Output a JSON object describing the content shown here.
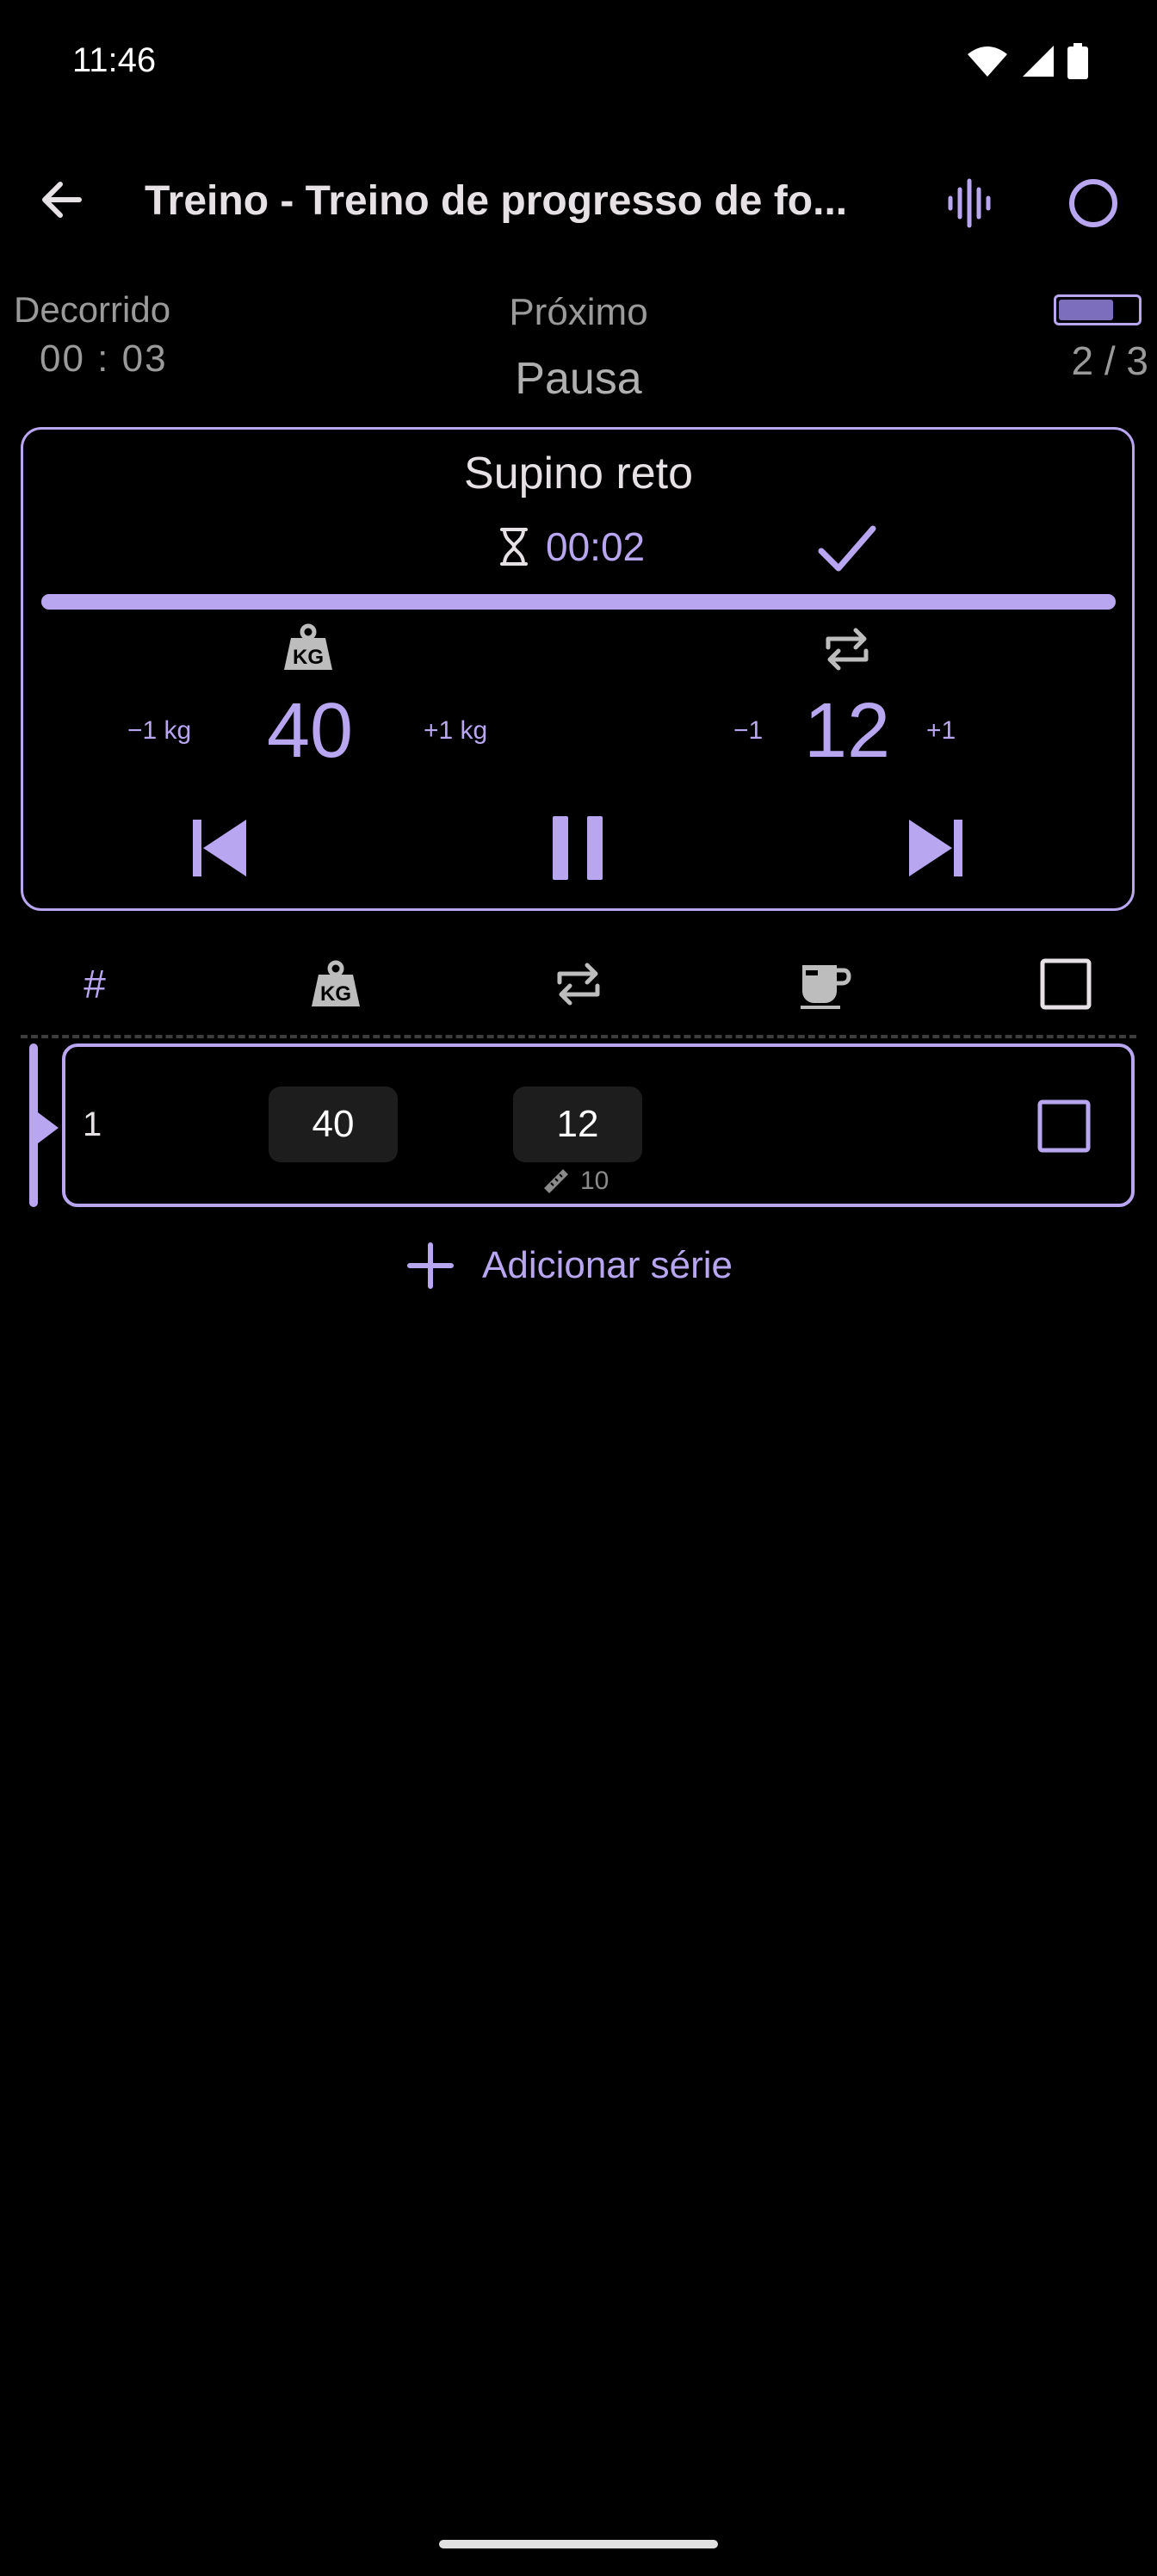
{
  "status_bar": {
    "time": "11:46"
  },
  "app_bar": {
    "title": "Treino - Treino de progresso de fo..."
  },
  "info": {
    "elapsed_label": "Decorrido",
    "elapsed_value": "00 : 03",
    "next_label": "Próximo",
    "next_value": "Pausa",
    "progress_count": "2 / 3",
    "battery_level": 0.7
  },
  "exercise": {
    "name": "Supino reto",
    "timer": "00:02",
    "progress_fraction": 1.0,
    "weight": {
      "minus_label": "−1 kg",
      "value": "40",
      "plus_label": "+1 kg"
    },
    "reps": {
      "minus_label": "−1",
      "value": "12",
      "plus_label": "+1"
    }
  },
  "table": {
    "header_num": "#",
    "rows": [
      {
        "num": "1",
        "weight": "40",
        "reps": "12",
        "rpe": "10",
        "checked": false
      }
    ]
  },
  "add_set_label": "Adicionar série",
  "colors": {
    "accent": "#b8a6f0",
    "background": "#000000",
    "muted": "#9a9a9a"
  }
}
